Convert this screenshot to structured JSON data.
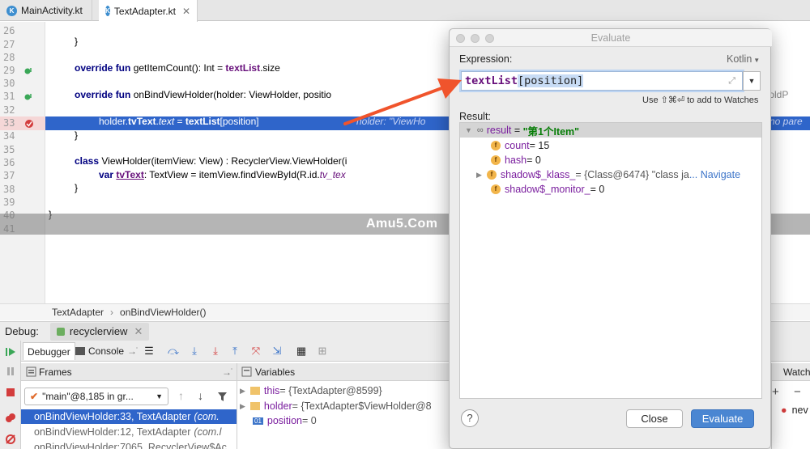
{
  "tabs": [
    {
      "label": "MainActivity.kt",
      "icon": "kotlin-file-icon"
    },
    {
      "label": "TextAdapter.kt",
      "icon": "kotlin-file-icon",
      "active": true
    }
  ],
  "editor": {
    "line_numbers": [
      "26",
      "27",
      "28",
      "29",
      "30",
      "31",
      "32",
      "33",
      "34",
      "35",
      "36",
      "37",
      "38",
      "39",
      "40",
      "41"
    ],
    "code": {
      "l26": "}",
      "l28_kw": "override fun ",
      "l28_rest": "getItemCount(): Int = ",
      "l28_field": "textList",
      "l28_tail": ".size",
      "l30_kw": "override fun ",
      "l30_rest": "onBindViewHolder(holder: ViewHolder, positio",
      "l30_trunc": "l, oldP",
      "l32_a": "holder.",
      "l32_b": "tvText",
      "l32_c": ".",
      "l32_d": "text",
      "l32_e": " = ",
      "l32_f": "textList",
      "l32_g": "[position]",
      "l32_hint": "holder: \"ViewHo",
      "l32_hint_right": "no pare",
      "l33": "}",
      "l35_kw": "class ",
      "l35_rest": "ViewHolder(itemView: View) : RecyclerView.ViewHolder(i",
      "l36_kw": "var ",
      "l36_field": "tvText",
      "l36_rest": ": TextView = itemView.findViewById(R.id.",
      "l36_it": "tv_tex",
      "l37": "}",
      "l39": "}"
    },
    "watermark": "Amu5.Com"
  },
  "breadcrumb": [
    "TextAdapter",
    "onBindViewHolder()"
  ],
  "debug": {
    "label": "Debug:",
    "session": "recyclerview",
    "tabs": [
      "Debugger",
      "Console"
    ],
    "frames_title": "Frames",
    "variables_title": "Variables",
    "watches_title": "Watch",
    "thread": "\"main\"@8,185 in gr...",
    "frames": [
      {
        "method": "onBindViewHolder:33, TextAdapter",
        "pkg": "(com.",
        "selected": true
      },
      {
        "method": "onBindViewHolder:12, TextAdapter",
        "pkg": "(com.l",
        "selected": false
      },
      {
        "method": "onBindViewHolder:7065, RecyclerView$Ac",
        "pkg": "",
        "selected": false
      }
    ],
    "variables": [
      {
        "name": "this",
        "value": " = {TextAdapter@8599}"
      },
      {
        "name": "holder",
        "value": " = {TextAdapter$ViewHolder@8"
      },
      {
        "name": "position",
        "value": " = 0"
      }
    ],
    "watch_item": "nev"
  },
  "dialog": {
    "title": "Evaluate",
    "expression_label": "Expression:",
    "language": "Kotlin",
    "expr_part1": "textList",
    "expr_part2": "[position]",
    "watches_hint": "Use ⇧⌘⏎ to add to Watches",
    "result_label": "Result:",
    "result": {
      "name": "result",
      "value": "\"第1个Item\"",
      "children": [
        {
          "name": "count",
          "value": " = 15"
        },
        {
          "name": "hash",
          "value": " = 0"
        },
        {
          "name": "shadow$_klass_",
          "value": " = {Class@6474} \"class ja",
          "link": "... Navigate"
        },
        {
          "name": "shadow$_monitor_",
          "value": " = 0"
        }
      ]
    },
    "close_label": "Close",
    "evaluate_label": "Evaluate",
    "help_label": "?"
  },
  "colors": {
    "current_line": "#2f65ca",
    "annotation_arrow": "#f0542c",
    "evaluate_button": "#4a86d2"
  }
}
